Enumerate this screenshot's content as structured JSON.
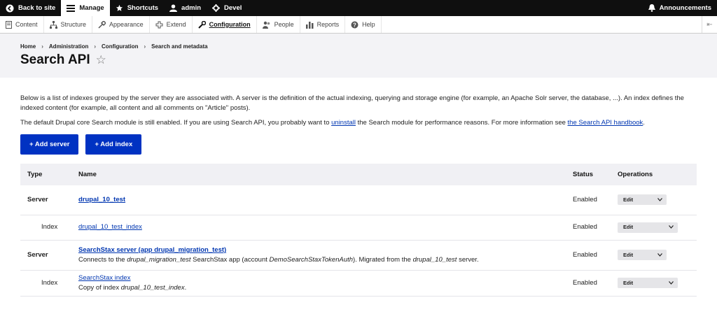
{
  "toolbar": {
    "back_label": "Back to site",
    "manage_label": "Manage",
    "shortcuts_label": "Shortcuts",
    "user_label": "admin",
    "devel_label": "Devel",
    "announcements_label": "Announcements"
  },
  "tray": {
    "items": [
      {
        "label": "Content",
        "icon": "content-icon"
      },
      {
        "label": "Structure",
        "icon": "structure-icon"
      },
      {
        "label": "Appearance",
        "icon": "appearance-icon"
      },
      {
        "label": "Extend",
        "icon": "extend-icon"
      },
      {
        "label": "Configuration",
        "icon": "wrench-icon"
      },
      {
        "label": "People",
        "icon": "people-icon"
      },
      {
        "label": "Reports",
        "icon": "reports-icon"
      },
      {
        "label": "Help",
        "icon": "help-icon"
      }
    ]
  },
  "breadcrumb": [
    "Home",
    "Administration",
    "Configuration",
    "Search and metadata"
  ],
  "page": {
    "title": "Search API",
    "desc1": "Below is a list of indexes grouped by the server they are associated with. A server is the definition of the actual indexing, querying and storage engine (for example, an Apache Solr server, the database, ...). An index defines the indexed content (for example, all content and all comments on \"Article\" posts).",
    "desc2_pre": "The default Drupal core Search module is still enabled. If you are using Search API, you probably want to ",
    "desc2_link1": "uninstall",
    "desc2_mid": " the Search module for performance reasons. For more information see ",
    "desc2_link2": "the Search API handbook",
    "desc2_end": ".",
    "add_server": "+ Add server",
    "add_index": "+ Add index"
  },
  "table": {
    "headers": {
      "type": "Type",
      "name": "Name",
      "status": "Status",
      "operations": "Operations"
    },
    "rows": [
      {
        "type": "Server",
        "name": "drupal_10_test",
        "desc_pre": "",
        "status": "Enabled",
        "op": "Edit"
      },
      {
        "type": "Index",
        "name": "drupal_10_test_index",
        "status": "Enabled",
        "op": "Edit"
      },
      {
        "type": "Server",
        "name": "SearchStax server (app drupal_migration_test)",
        "desc_a": "Connects to the ",
        "desc_b": "drupal_migration_test",
        "desc_c": " SearchStax app (account ",
        "desc_d": "DemoSearchStaxTokenAuth",
        "desc_e": "). Migrated from the ",
        "desc_f": "drupal_10_test",
        "desc_g": " server.",
        "status": "Enabled",
        "op": "Edit"
      },
      {
        "type": "Index",
        "name": "SearchStax index",
        "desc_a": "Copy of index ",
        "desc_b": "drupal_10_test_index",
        "desc_c": ".",
        "status": "Enabled",
        "op": "Edit"
      }
    ]
  },
  "colors": {
    "primary_button": "#0032c2",
    "link": "#0036b1",
    "toolbar": "#0f0f0f"
  }
}
